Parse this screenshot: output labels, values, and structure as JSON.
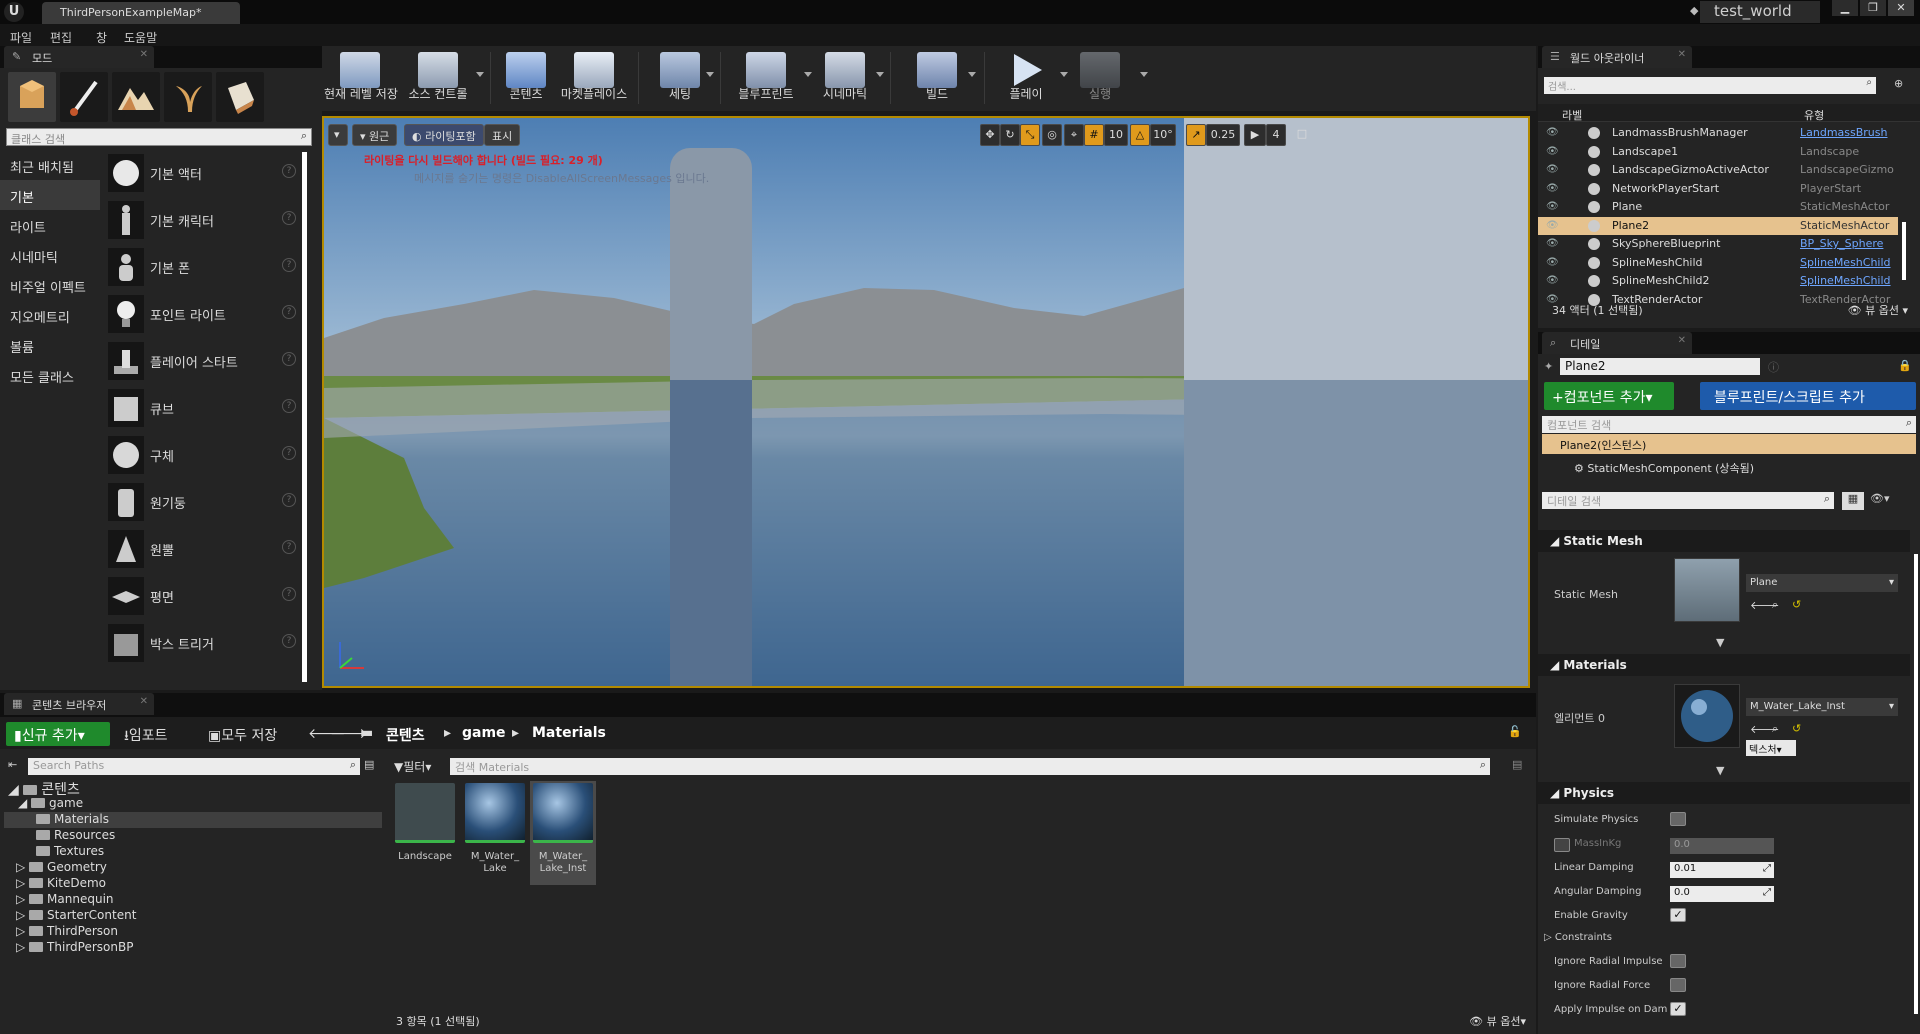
{
  "window": {
    "doc_tab": "ThirdPersonExampleMap*",
    "world_name": "test_world"
  },
  "menu": [
    "파일",
    "편집",
    "창",
    "도움말"
  ],
  "modes": {
    "tab": "모드",
    "search_placeholder": "클래스 검색",
    "categories": [
      "최근 배치됨",
      "기본",
      "라이트",
      "시네마틱",
      "비주얼 이펙트",
      "지오메트리",
      "볼륨",
      "모든 클래스"
    ],
    "items": [
      "기본 액터",
      "기본 캐릭터",
      "기본 폰",
      "포인트 라이트",
      "플레이어 스타트",
      "큐브",
      "구체",
      "원기둥",
      "원뿔",
      "평면",
      "박스 트리거"
    ]
  },
  "toolbar": {
    "buttons": [
      "현재 레벨 저장",
      "소스 컨트롤",
      "콘텐츠",
      "마켓플레이스",
      "세팅",
      "블루프린트",
      "시네마틱",
      "빌드",
      "플레이",
      "실행"
    ]
  },
  "viewport": {
    "perspective": "원근",
    "lighting": "라이팅포함",
    "show": "표시",
    "warning": "라이팅을 다시 빌드해야 합니다 (빌드 필요: 29 개)",
    "hint": "메시지를 숨기는 명령은 DisableAllScreenMessages 입니다.",
    "grid_snap": "10",
    "rot_snap": "10°",
    "scale_snap": "0.25",
    "cam_speed": "4"
  },
  "outliner": {
    "tab": "월드 아웃라이너",
    "search_placeholder": "검색...",
    "col_label": "라벨",
    "col_type": "유형",
    "rows": [
      {
        "name": "LandmassBrushManager",
        "type": "LandmassBrush",
        "link": true
      },
      {
        "name": "Landscape1",
        "type": "Landscape",
        "link": false
      },
      {
        "name": "LandscapeGizmoActiveActor",
        "type": "LandscapeGizmo",
        "link": false
      },
      {
        "name": "NetworkPlayerStart",
        "type": "PlayerStart",
        "link": false
      },
      {
        "name": "Plane",
        "type": "StaticMeshActor",
        "link": false
      },
      {
        "name": "Plane2",
        "type": "StaticMeshActor",
        "link": false
      },
      {
        "name": "SkySphereBlueprint",
        "type": "BP_Sky_Sphere",
        "link": true
      },
      {
        "name": "SplineMeshChild",
        "type": "SplineMeshChild",
        "link": true
      },
      {
        "name": "SplineMeshChild2",
        "type": "SplineMeshChild",
        "link": true
      },
      {
        "name": "TextRenderActor",
        "type": "TextRenderActor",
        "link": false
      }
    ],
    "selected_index": 5,
    "count": "34 액터 (1 선택됨)",
    "view_options": "뷰 옵션"
  },
  "details": {
    "tab": "디테일",
    "name": "Plane2",
    "add_component": "컴포넌트 추가",
    "add_blueprint": "블루프린트/스크립트 추가",
    "component_search": "컴포넌트 검색",
    "instance": "Plane2(인스턴스)",
    "mesh_component": "StaticMeshComponent (상속됨)",
    "detail_search": "디테일 검색",
    "static_mesh_section": "Static Mesh",
    "static_mesh_label": "Static Mesh",
    "static_mesh_value": "Plane",
    "materials_section": "Materials",
    "element_label": "엘리먼트 0",
    "material_value": "M_Water_Lake_Inst",
    "texture_btn": "텍스처",
    "physics_section": "Physics",
    "simulate_physics": "Simulate Physics",
    "mass_label": "MassInKg",
    "mass_value": "0.0",
    "linear_damping": "Linear Damping",
    "linear_damping_value": "0.01",
    "angular_damping": "Angular Damping",
    "angular_damping_value": "0.0",
    "enable_gravity": "Enable Gravity",
    "constraints": "Constraints",
    "ignore_impulse": "Ignore Radial Impulse",
    "ignore_force": "Ignore Radial Force",
    "apply_impulse": "Apply Impulse on Dam"
  },
  "content_browser": {
    "tab": "콘텐츠 브라우저",
    "new": "신규 추가",
    "import": "임포트",
    "save_all": "모두 저장",
    "crumbs": [
      "콘텐츠",
      "game",
      "Materials"
    ],
    "path_search": "Search Paths",
    "filter": "필터",
    "asset_search": "검색 Materials",
    "tree": {
      "root": "콘텐츠",
      "game": "game",
      "game_children": [
        "Materials",
        "Resources",
        "Textures"
      ],
      "others": [
        "Geometry",
        "KiteDemo",
        "Mannequin",
        "StarterContent",
        "ThirdPerson",
        "ThirdPersonBP"
      ]
    },
    "assets": [
      "Landscape",
      "M_Water_\nLake",
      "M_Water_\nLake_Inst"
    ],
    "count": "3 항목 (1 선택됨)",
    "view_options": "뷰 옵션"
  }
}
